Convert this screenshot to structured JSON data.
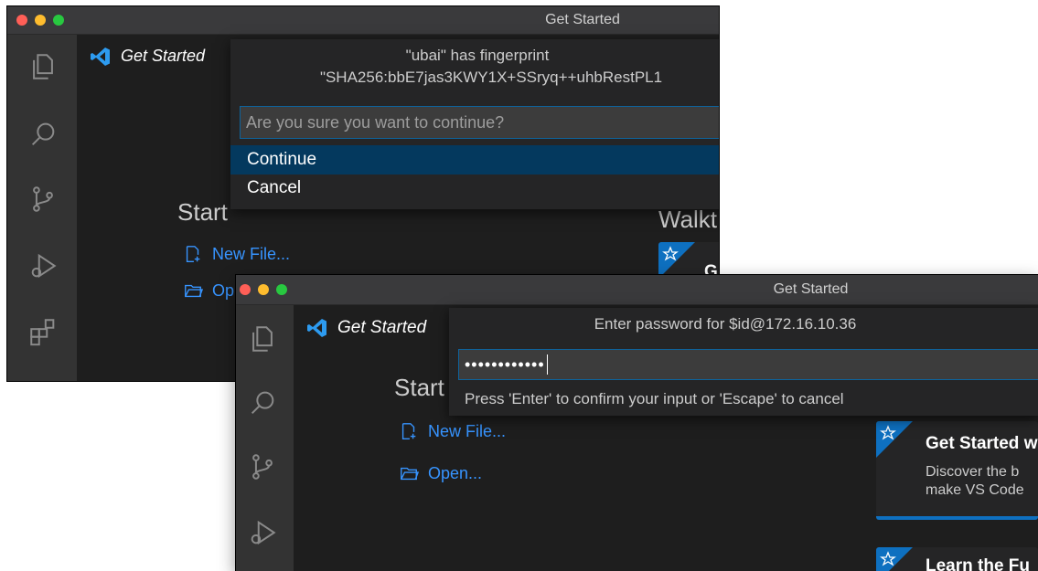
{
  "win1": {
    "title": "Get Started",
    "tab_label": "Get Started",
    "start_heading": "Start",
    "new_file": "New File...",
    "open": "Op",
    "walkthrough_heading": "Walkt",
    "card_title": "G",
    "quickpick": {
      "title_line1": "\"ubai\" has fingerprint",
      "title_line2": "\"SHA256:bbE7jas3KWY1X+SSryq++uhbRestPL1",
      "input_placeholder": "Are you sure you want to continue?",
      "items": [
        {
          "label": "Continue",
          "active": true
        },
        {
          "label": "Cancel",
          "active": false
        }
      ]
    }
  },
  "win2": {
    "title": "Get Started",
    "tab_label": "Get Started",
    "start_heading": "Start",
    "new_file": "New File...",
    "open": "Open...",
    "quickpick": {
      "title": "Enter password for $id@172.16.10.36",
      "input_value": "••••••••••••",
      "hint": "Press 'Enter' to confirm your input or 'Escape' to cancel"
    },
    "card1": {
      "title": "Get Started w",
      "desc_line1": "Discover the b",
      "desc_line2": "make VS Code"
    },
    "card2": {
      "title": "Learn the Fu"
    }
  },
  "colors": {
    "accent": "#3794ff",
    "selection": "#04395e",
    "focus_border": "#0e639c"
  }
}
